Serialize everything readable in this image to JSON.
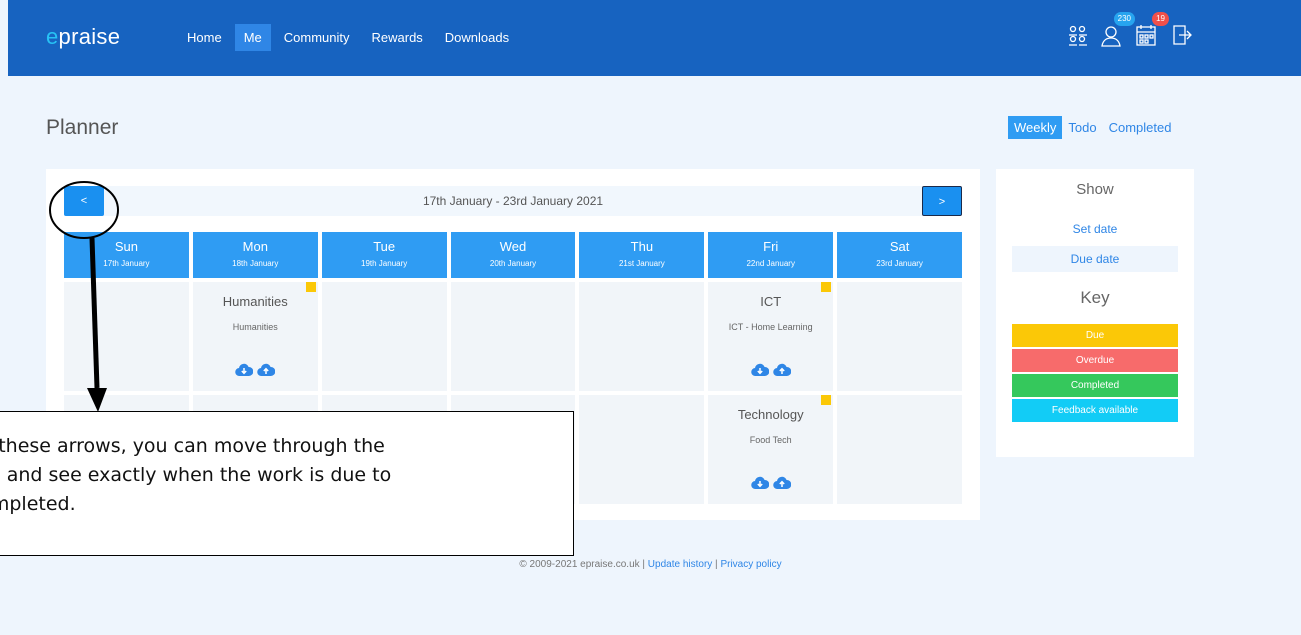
{
  "app": {
    "logo_prefix": "e",
    "logo_rest": "praise"
  },
  "nav": {
    "items": [
      {
        "label": "Home",
        "active": false
      },
      {
        "label": "Me",
        "active": true
      },
      {
        "label": "Community",
        "active": false
      },
      {
        "label": "Rewards",
        "active": false
      },
      {
        "label": "Downloads",
        "active": false
      }
    ]
  },
  "header_icons": {
    "groups_icon": "groups-icon",
    "profile_badge": "230",
    "planner_badge": "19"
  },
  "page": {
    "title": "Planner",
    "view_tabs": [
      {
        "label": "Weekly",
        "active": true
      },
      {
        "label": "Todo",
        "active": false
      },
      {
        "label": "Completed",
        "active": false
      }
    ]
  },
  "planner": {
    "prev_label": "<",
    "next_label": ">",
    "range": "17th January - 23rd January 2021",
    "days": [
      {
        "name": "Sun",
        "date": "17th January"
      },
      {
        "name": "Mon",
        "date": "18th January"
      },
      {
        "name": "Tue",
        "date": "19th January"
      },
      {
        "name": "Wed",
        "date": "20th January"
      },
      {
        "name": "Thu",
        "date": "21st January"
      },
      {
        "name": "Fri",
        "date": "22nd January"
      },
      {
        "name": "Sat",
        "date": "23rd January"
      }
    ],
    "tasks": {
      "mon_1": {
        "subject": "Humanities",
        "detail": "Humanities"
      },
      "fri_1": {
        "subject": "ICT",
        "detail": "ICT - Home Learning"
      },
      "fri_2": {
        "subject": "Technology",
        "detail": "Food Tech"
      }
    }
  },
  "side": {
    "show_heading": "Show",
    "set_date": "Set date",
    "due_date": "Due date",
    "key_heading": "Key",
    "key": [
      {
        "label": "Due",
        "color": "#fbc807"
      },
      {
        "label": "Overdue",
        "color": "#f76b6b"
      },
      {
        "label": "Completed",
        "color": "#35c85c"
      },
      {
        "label": "Feedback available",
        "color": "#12ccf6"
      }
    ]
  },
  "footer": {
    "copyright": "© 2009-2021 epraise.co.uk",
    "sep1": " | ",
    "update_history": "Update history",
    "sep2": " | ",
    "privacy_policy": "Privacy policy"
  },
  "annotation": {
    "line1": "Using these arrows, you can move through the",
    "line2": "month and see exactly when the work is due to",
    "line3": "be completed."
  },
  "colors": {
    "topbar": "#1763c0",
    "primary": "#2f9cf3",
    "due_marker": "#fbc807"
  }
}
